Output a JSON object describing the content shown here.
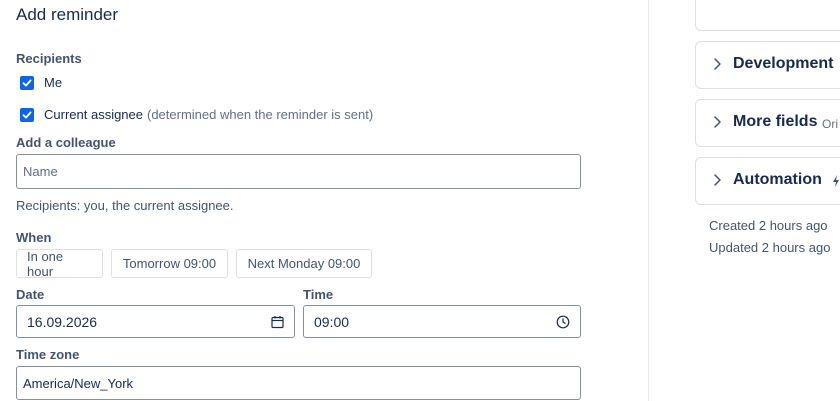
{
  "reminder": {
    "title": "Add reminder",
    "recipients_label": "Recipients",
    "recipient_me": "Me",
    "recipient_assignee": "Current assignee",
    "recipient_assignee_note": "(determined when the reminder is sent)",
    "colleague_label": "Add a colleague",
    "colleague_placeholder": "Name",
    "recipients_summary": "Recipients: you, the current assignee.",
    "when_label": "When",
    "quick_options": [
      "In one hour",
      "Tomorrow 09:00",
      "Next Monday 09:00"
    ],
    "date_label": "Date",
    "date_value": "16.09.2026",
    "time_label": "Time",
    "time_value": "09:00",
    "timezone_label": "Time zone",
    "timezone_value": "America/New_York",
    "me_checked": true,
    "assignee_checked": true
  },
  "side_panel": {
    "sections": [
      {
        "title": "Development",
        "extra": ""
      },
      {
        "title": "More fields",
        "extra": "Ori"
      },
      {
        "title": "Automation",
        "extra": ""
      }
    ],
    "created": "Created 2 hours ago",
    "updated": "Updated 2 hours ago"
  },
  "colors": {
    "accent": "#0c66e4",
    "text": "#172b4d",
    "muted": "#626f86",
    "border": "#8590a2"
  }
}
